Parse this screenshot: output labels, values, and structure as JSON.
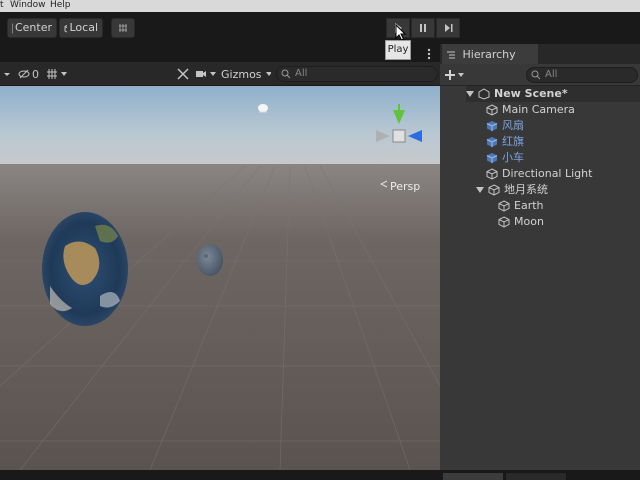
{
  "menubar": {
    "items": [
      "t",
      "Window",
      "Help"
    ]
  },
  "toolbar": {
    "pivot_center": "Center",
    "pivot_local": "Local",
    "play_tooltip": "Play"
  },
  "scene": {
    "toolbar": {
      "visible_count": "0",
      "gizmos": "Gizmos",
      "search_placeholder": "All"
    },
    "persp_label": "Persp"
  },
  "hierarchy": {
    "tab_title": "Hierarchy",
    "search_placeholder": "All",
    "scene_name": "New Scene*",
    "items": [
      {
        "label": "Main Camera",
        "depth": 1,
        "prefab": false
      },
      {
        "label": "风扇",
        "depth": 1,
        "prefab": true
      },
      {
        "label": "红旗",
        "depth": 1,
        "prefab": true
      },
      {
        "label": "小车",
        "depth": 1,
        "prefab": true
      },
      {
        "label": "Directional Light",
        "depth": 1,
        "prefab": false
      },
      {
        "label": "地月系统",
        "depth": 1,
        "prefab": false,
        "expanded": true
      },
      {
        "label": "Earth",
        "depth": 2,
        "prefab": false
      },
      {
        "label": "Moon",
        "depth": 2,
        "prefab": false
      }
    ]
  },
  "colors": {
    "prefab_text": "#7ba3e0",
    "axis_x": "#e0343a",
    "axis_y": "#5ec43a",
    "axis_z": "#2c6be0"
  }
}
